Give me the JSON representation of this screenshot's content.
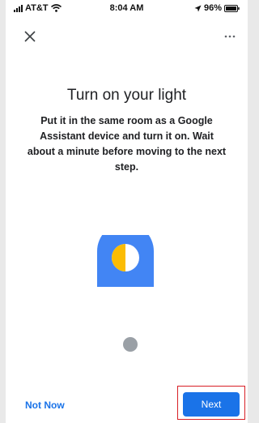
{
  "status_bar": {
    "carrier": "AT&T",
    "time": "8:04 AM",
    "battery": "96%"
  },
  "header": {
    "close_icon": "close-icon",
    "more_icon": "more-horiz-icon"
  },
  "content": {
    "title": "Turn on your light",
    "description": "Put it in the same room as a Google Assistant device and turn it on. Wait about a minute before moving to the next step."
  },
  "illustration": {
    "speaker_color": "#4285f4",
    "light_half_color": "#fbbc04",
    "dot_color": "#9aa0a6"
  },
  "footer": {
    "secondary_label": "Not Now",
    "primary_label": "Next"
  },
  "colors": {
    "accent": "#1a73e8",
    "highlight_border": "#d81f26"
  }
}
